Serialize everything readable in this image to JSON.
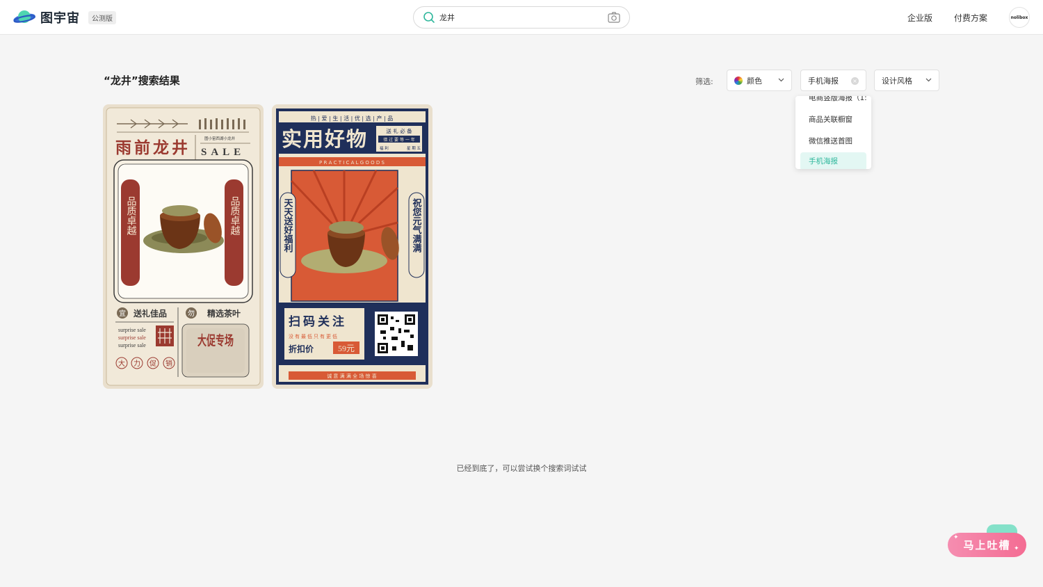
{
  "header": {
    "logo_text": "图宇宙",
    "beta_badge": "公测版",
    "search": {
      "value": "龙井",
      "placeholder": ""
    },
    "nav": {
      "enterprise": "企业版",
      "pricing": "付费方案"
    },
    "avatar_text": "nolibox"
  },
  "results": {
    "title": "“龙井”搜索结果",
    "filter_label": "筛选:",
    "filters": {
      "color": "颜色",
      "size": "手机海报",
      "style": "设计风格"
    },
    "dropdown": {
      "items": [
        "电商竖版海报（1:",
        "商品关联橱窗",
        "微信推送首图",
        "手机海报"
      ],
      "selected": "手机海报"
    },
    "end_text": "已经到底了，可以尝试换个搜索词试试"
  },
  "cards": [
    {
      "title": "雨前龙井",
      "subtitle": "图小宙西湖小龙井",
      "sale": "SALE",
      "left_tag": "品质卓越",
      "right_tag": "品质卓越",
      "gift": "送礼佳品",
      "tea": "精选茶叶",
      "gift_badge": "宜",
      "tea_badge": "勿",
      "surprise": [
        "surprise sale",
        "surprise sale",
        "surprise sale"
      ],
      "bottom": [
        "大",
        "力",
        "促",
        "销"
      ],
      "promo": "大促专场"
    },
    {
      "top_line": "热 | 爱 | 生 | 活 | 优 | 选 | 产 | 品",
      "title": "实用好物",
      "box_line1": "送 礼 必 备",
      "box_line2": "错 过 要 等 一 年",
      "box_line3": "福 利",
      "box_line4": "星 期 五",
      "english": "P R A C T I C A L   G O O D S",
      "left_vert": "天天送好福利",
      "right_vert": "祝您元气满满",
      "scan": "扫码关注",
      "small_line": "没有最低只有更低",
      "discount": "折扣价",
      "price": "59元",
      "footer": "诚 意 满 满 全 场 惊 喜"
    }
  ],
  "feedback_button": "马上吐槽",
  "colors": {
    "accent": "#2fb79c",
    "poster_red": "#9b3a30",
    "poster_navy": "#1f2f5a",
    "poster_orange": "#d85a36"
  }
}
